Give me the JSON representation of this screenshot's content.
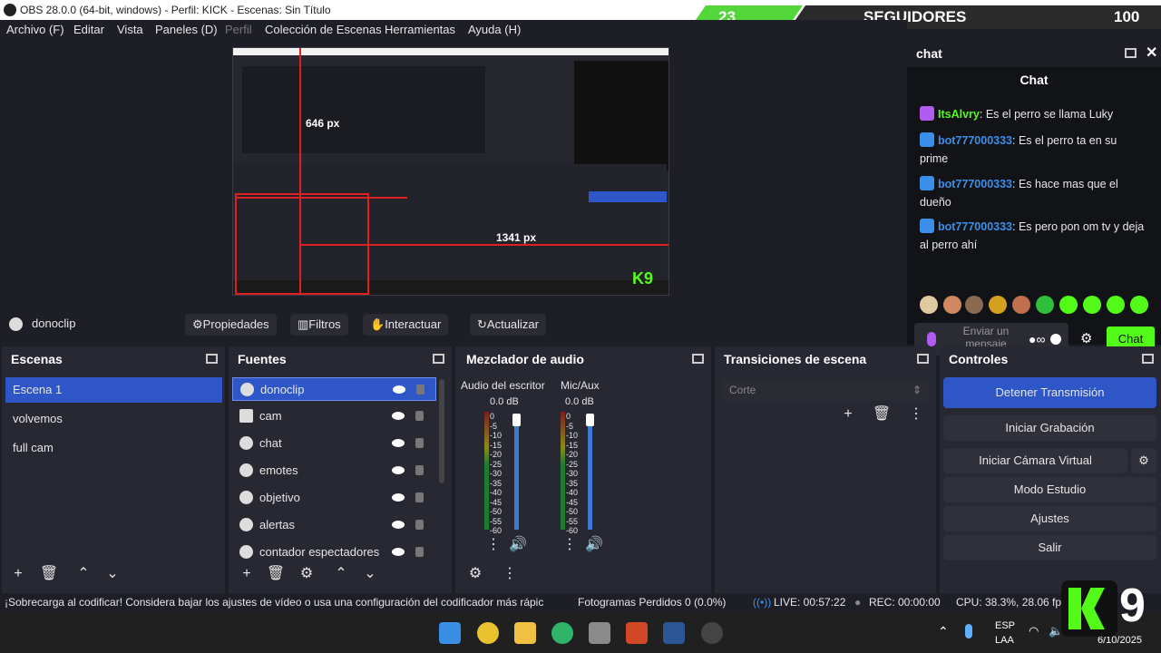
{
  "window": {
    "title": "OBS 28.0.0 (64-bit, windows) - Perfil: KICK - Escenas: Sin Título"
  },
  "follow_bar": {
    "current": "23",
    "label": "SEGUIDORES",
    "goal": "100"
  },
  "menu": [
    {
      "label": "Archivo (F)",
      "enabled": true
    },
    {
      "label": "Editar",
      "enabled": true
    },
    {
      "label": "Vista",
      "enabled": true
    },
    {
      "label": "Paneles (D)",
      "enabled": true
    },
    {
      "label": "Perfil",
      "enabled": false
    },
    {
      "label": "Colección de Escenas",
      "enabled": true
    },
    {
      "label": "Herramientas",
      "enabled": true
    },
    {
      "label": "Ayuda (H)",
      "enabled": true
    }
  ],
  "preview": {
    "height_label": "646 px",
    "width_label": "1341 px"
  },
  "chat": {
    "dock_title": "chat",
    "panel_title": "Chat",
    "messages": [
      {
        "user": "ItsAlvry",
        "text": "Es el perro se llama Luky",
        "badge_color": "#b05cf0"
      },
      {
        "user": "bot777000333",
        "text": "Es el perro ta en su prime",
        "badge_color": "#3b8fe8"
      },
      {
        "user": "bot777000333",
        "text": "Es hace mas que el dueño",
        "badge_color": "#3b8fe8"
      },
      {
        "user": "bot777000333",
        "text": "Es pero pon om tv y deja al perro ahí",
        "badge_color": "#3b8fe8"
      }
    ],
    "input_placeholder": "Enviar un mensaje",
    "send_label": "Chat",
    "accent": "#53fc18",
    "user_color": "#53fc18"
  },
  "source_toolbar": {
    "source_name": "donoclip",
    "properties": "Propiedades",
    "filters": "Filtros",
    "interact": "Interactuar",
    "refresh": "Actualizar"
  },
  "scenes": {
    "title": "Escenas",
    "items": [
      "Escena 1",
      "volvemos",
      "full cam"
    ],
    "selected": "Escena 1"
  },
  "sources": {
    "title": "Fuentes",
    "items": [
      "donoclip",
      "cam",
      "chat",
      "emotes",
      "objetivo",
      "alertas",
      "contador espectadores"
    ],
    "selected": "donoclip"
  },
  "mixer": {
    "title": "Mezclador de audio",
    "channels": [
      {
        "name": "Audio del escritor",
        "db": "0.0 dB"
      },
      {
        "name": "Mic/Aux",
        "db": "0.0 dB"
      }
    ],
    "scale": [
      "0",
      "-5",
      "-10",
      "-15",
      "-20",
      "-25",
      "-30",
      "-35",
      "-40",
      "-45",
      "-50",
      "-55",
      "-60"
    ]
  },
  "transitions": {
    "title": "Transiciones de escena",
    "selected": "Corte"
  },
  "controls": {
    "title": "Controles",
    "stop_stream": "Detener Transmisión",
    "start_recording": "Iniciar Grabación",
    "virtual_cam": "Iniciar Cámara Virtual",
    "studio_mode": "Modo Estudio",
    "settings": "Ajustes",
    "exit": "Salir"
  },
  "status": {
    "warning": "¡Sobrecarga al codificar! Considera bajar los ajustes de vídeo o usa una configuración del codificador más rápic",
    "dropped_frames": "Fotogramas Perdidos 0 (0.0%)",
    "live": "LIVE: 00:57:22",
    "rec": "REC: 00:00:00",
    "cpu": "CPU: 38.3%, 28.06 fps"
  },
  "taskbar": {
    "lang_top": "ESP",
    "lang_bottom": "LAA",
    "date": "6/10/2025"
  },
  "overlay_logo": {
    "text": "9"
  },
  "colors": {
    "selection": "#2f56c7",
    "panel": "#272831",
    "background": "#1e1f26"
  }
}
